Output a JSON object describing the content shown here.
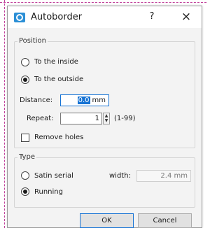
{
  "window": {
    "title": "Autoborder",
    "help_label": "?",
    "close_label": "×"
  },
  "position": {
    "title": "Position",
    "inside_label": "To the inside",
    "outside_label": "To the outside",
    "selected": "outside",
    "distance_label": "Distance:",
    "distance_value": "0.0",
    "distance_unit": "mm",
    "repeat_label": "Repeat:",
    "repeat_value": "1",
    "repeat_range": "(1-99)",
    "remove_holes_label": "Remove holes",
    "remove_holes_checked": false
  },
  "type": {
    "title": "Type",
    "satin_label": "Satin serial",
    "running_label": "Running",
    "selected": "running",
    "width_label": "width:",
    "width_value": "2.4 mm"
  },
  "buttons": {
    "ok_label": "OK",
    "cancel_label": "Cancel"
  },
  "colors": {
    "accent": "#1673d4",
    "guide_dashes": "#c0409a",
    "app_icon": "#2b8fd6"
  }
}
